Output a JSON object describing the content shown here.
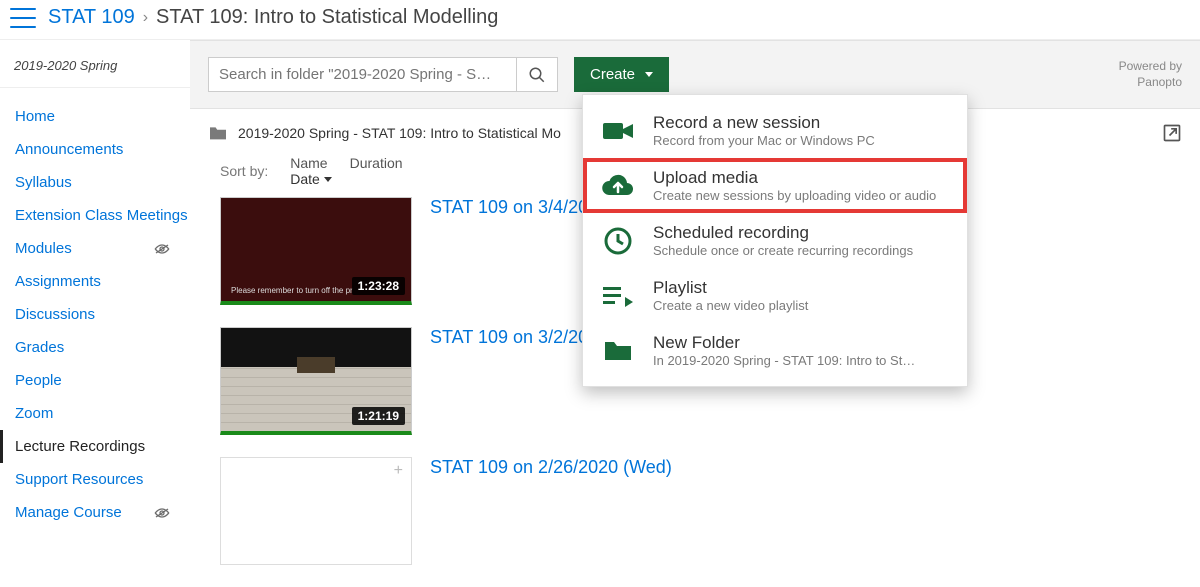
{
  "breadcrumb": {
    "course_code": "STAT 109",
    "sep": "›",
    "course_title": "STAT 109: Intro to Statistical Modelling"
  },
  "sidebar": {
    "term": "2019-2020 Spring",
    "items": [
      {
        "label": "Home",
        "hidden": false
      },
      {
        "label": "Announcements",
        "hidden": false
      },
      {
        "label": "Syllabus",
        "hidden": false
      },
      {
        "label": "Extension Class Meetings",
        "hidden": false
      },
      {
        "label": "Modules",
        "hidden": true
      },
      {
        "label": "Assignments",
        "hidden": false
      },
      {
        "label": "Discussions",
        "hidden": false
      },
      {
        "label": "Grades",
        "hidden": false
      },
      {
        "label": "People",
        "hidden": false
      },
      {
        "label": "Zoom",
        "hidden": false
      },
      {
        "label": "Lecture Recordings",
        "hidden": false,
        "active": true
      },
      {
        "label": "Support Resources",
        "hidden": false
      },
      {
        "label": "Manage Course",
        "hidden": true
      }
    ]
  },
  "toolbar": {
    "search_placeholder": "Search in folder \"2019-2020 Spring - S…",
    "create_label": "Create",
    "powered_line1": "Powered by",
    "powered_line2": "Panopto"
  },
  "folder": {
    "title": "2019-2020 Spring - STAT 109: Intro to Statistical Mo"
  },
  "sort": {
    "label": "Sort by:",
    "options": [
      "Name",
      "Duration",
      "Date"
    ],
    "active": "Date"
  },
  "videos": [
    {
      "title": "STAT 109 on 3/4/20",
      "thumb": "maroon",
      "duration": "1:23:28",
      "caption": "Please remember to turn off the pr"
    },
    {
      "title": "STAT 109 on 3/2/20",
      "thumb": "classroom",
      "duration": "1:21:19"
    },
    {
      "title": "STAT 109 on 2/26/2020 (Wed)",
      "thumb": "blank"
    }
  ],
  "create_menu": [
    {
      "icon": "camera",
      "title": "Record a new session",
      "sub": "Record from your Mac or Windows PC",
      "highlight": false
    },
    {
      "icon": "upload",
      "title": "Upload media",
      "sub": "Create new sessions by uploading video or audio",
      "highlight": true
    },
    {
      "icon": "clock",
      "title": "Scheduled recording",
      "sub": "Schedule once or create recurring recordings",
      "highlight": false
    },
    {
      "icon": "playlist",
      "title": "Playlist",
      "sub": "Create a new video playlist",
      "highlight": false
    },
    {
      "icon": "folder",
      "title": "New Folder",
      "sub": "In 2019-2020 Spring - STAT 109: Intro to St…",
      "highlight": false
    }
  ]
}
